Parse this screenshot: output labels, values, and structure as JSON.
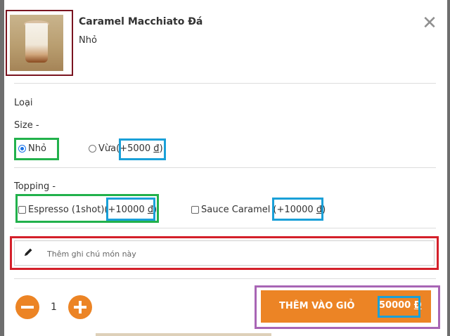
{
  "product": {
    "name": "Caramel Macchiato Đá",
    "variant": "Nhỏ",
    "close_symbol": "✕"
  },
  "type_section": {
    "label": "Loại"
  },
  "size_section": {
    "label": "Size -",
    "options": [
      {
        "label": "Nhỏ",
        "selected": true,
        "price_prefix": "",
        "price_value": "",
        "currency": ""
      },
      {
        "label": "Vừa",
        "selected": false,
        "price_prefix": "(+5000 ",
        "currency": "đ",
        "price_suffix": ")"
      }
    ]
  },
  "topping_section": {
    "label": "Topping -",
    "options": [
      {
        "label": "Espresso (1shot)",
        "checked": false,
        "price_prefix": "(+10000 ",
        "currency": "đ",
        "price_suffix": ")"
      },
      {
        "label": "Sauce Caramel",
        "checked": false,
        "price_prefix": "(+10000 ",
        "currency": "đ",
        "price_suffix": ")"
      }
    ]
  },
  "note": {
    "placeholder": "Thêm ghi chú món này",
    "value": ""
  },
  "quantity": {
    "value": "1"
  },
  "add_to_cart": {
    "label": "THÊM VÀO GIỎ",
    "amount": "50000 ",
    "currency": "Đ"
  },
  "colors": {
    "accent": "#ec8425",
    "radio_selected": "#1a73e8",
    "highlight_green": "#22b14c",
    "highlight_blue": "#1aa0d8",
    "highlight_red": "#d4202a",
    "highlight_purple": "#a865b5",
    "highlight_maroon": "#7a1420"
  },
  "icons": {
    "close": "close-icon",
    "pencil": "pencil-icon",
    "minus": "minus-icon",
    "plus": "plus-icon"
  }
}
